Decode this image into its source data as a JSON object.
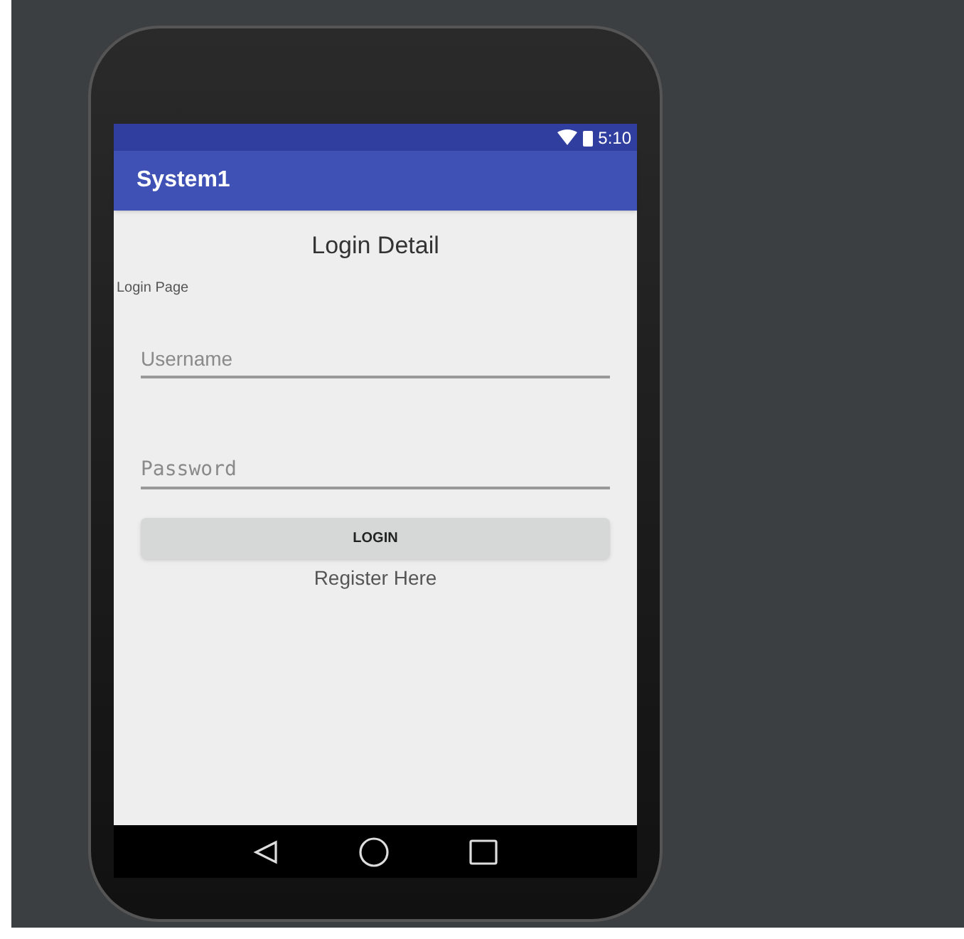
{
  "status_bar": {
    "time": "5:10"
  },
  "app_bar": {
    "title": "System1"
  },
  "content": {
    "heading": "Login Detail",
    "caption": "Login Page",
    "fields": [
      {
        "kind": "text",
        "placeholder": "Username"
      },
      {
        "kind": "password",
        "placeholder": "Password"
      }
    ],
    "login_button": "LOGIN",
    "register_link": "Register Here"
  }
}
